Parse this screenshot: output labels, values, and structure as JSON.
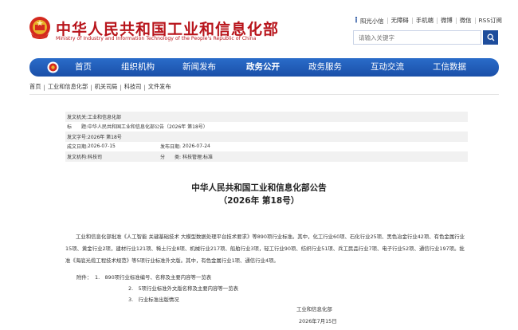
{
  "header": {
    "title_cn": "中华人民共和国工业和信息化部",
    "title_en": "Ministry of Industry and Information Technology of the People's Republic of China",
    "top_links": [
      "阳光小信",
      "无障碍",
      "手机端",
      "微博",
      "微信",
      "RSS订阅"
    ],
    "search_placeholder": "请输入关键字"
  },
  "nav": {
    "items": [
      "首页",
      "组织机构",
      "新闻发布",
      "政务公开",
      "政务服务",
      "互动交流",
      "工信数据"
    ],
    "active": "政务公开"
  },
  "breadcrumb": [
    "首页",
    "工业和信息化部",
    "机关司局",
    "科技司",
    "文件发布"
  ],
  "meta": {
    "issuer_label": "发文机关:",
    "issuer": "工业和信息化部",
    "title_label": "标　　题:",
    "title": "中华人民共和国工业和信息化部公告（2026年 第18号）",
    "docno_label": "发文字号:",
    "docno": "2026年 第18号",
    "created_label": "成文日期:",
    "created": "2026-07-15",
    "published_label": "发布日期:",
    "published": "2026-07-24",
    "dept_label": "发文机构:",
    "dept": "科技司",
    "category_label": "分　　类:",
    "category": "科技管理;标准"
  },
  "article": {
    "title_line1": "中华人民共和国工业和信息化部公告",
    "title_line2": "（2026年 第18号）",
    "paragraph": "工业和信息化部批准《人工智能 关键基础技术 大模型数据处理平台技术要求》等890项行业标准。其中，化工行业60项、石化行业25项、黑色冶金行业42项、有色金属行业15项、黄金行业2项，建材行业121项、稀土行业8项、机械行业217项、船舶行业3项，轻工行业90项、纺织行业51项、兵工民品行业7项、电子行业52项、通信行业197项。批准《海底光缆工程技术规范》等5项行业标准外文版。其中，有色金属行业1项、通信行业4项。",
    "attach_label": "附件：",
    "attachments": [
      "1.　890项行业标准编号、名称及主要内容等一览表",
      "2.　5项行业标准外文版名称及主要内容等一览表",
      "3.　行业标准出版情况"
    ],
    "signature": "工业和信息化部",
    "sign_date": "2026年7月15日"
  }
}
